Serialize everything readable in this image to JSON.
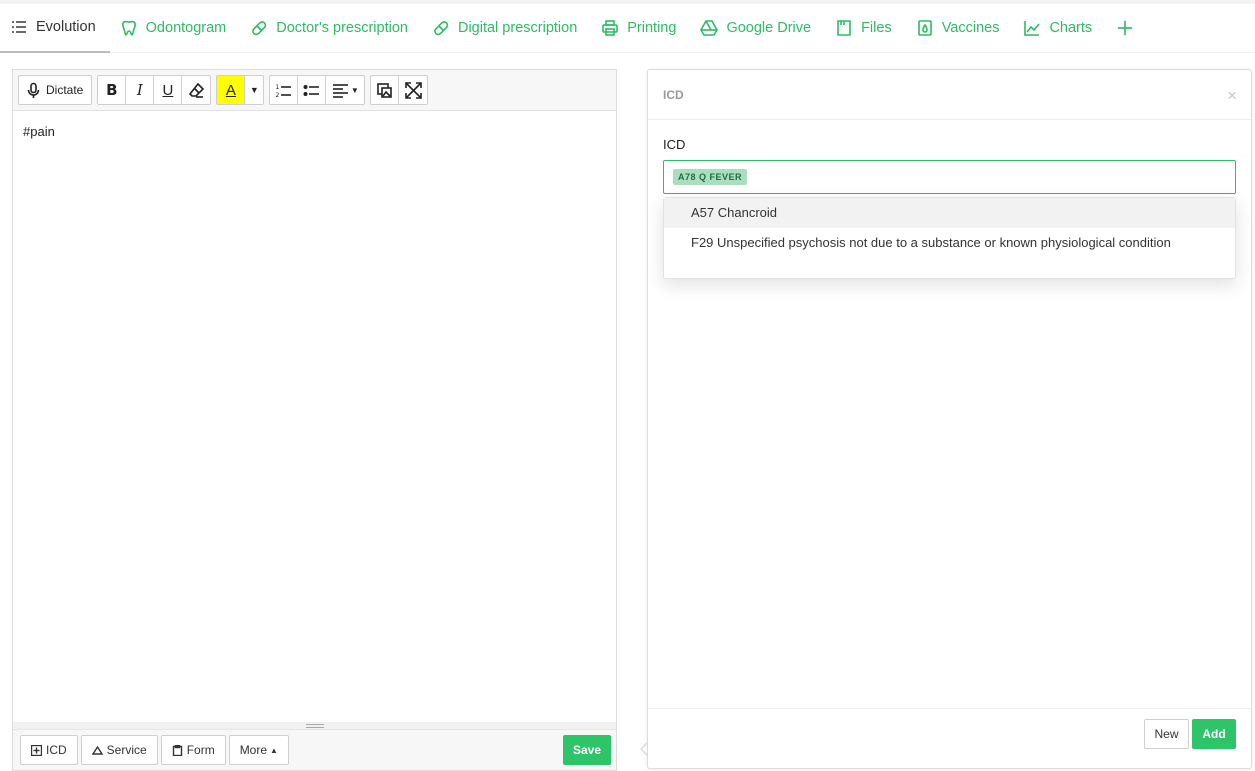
{
  "tabs": [
    {
      "label": "Evolution",
      "icon": "list-icon",
      "active": true
    },
    {
      "label": "Odontogram",
      "icon": "tooth-icon"
    },
    {
      "label": "Doctor's prescription",
      "icon": "pill-icon"
    },
    {
      "label": "Digital prescription",
      "icon": "pill-icon"
    },
    {
      "label": "Printing",
      "icon": "printer-icon"
    },
    {
      "label": "Google Drive",
      "icon": "google-drive-icon"
    },
    {
      "label": "Files",
      "icon": "file-icon"
    },
    {
      "label": "Vaccines",
      "icon": "vaccine-icon"
    },
    {
      "label": "Charts",
      "icon": "chart-icon"
    }
  ],
  "editor": {
    "toolbar": {
      "dictate_label": "Dictate",
      "bold_label": "B",
      "italic_label": "I",
      "underline_label": "U",
      "highlight_label": "A",
      "highlight_color": "#ffff00"
    },
    "content": "#pain",
    "footer": {
      "icd_label": "ICD",
      "service_label": "Service",
      "form_label": "Form",
      "more_label": "More",
      "save_label": "Save"
    }
  },
  "modal": {
    "title": "ICD",
    "close_symbol": "×",
    "field_label": "ICD",
    "selected_tag": "A78 Q FEVER",
    "options": [
      "A57 Chancroid",
      "F29 Unspecified psychosis not due to a substance or known physiological condition"
    ],
    "new_label": "New",
    "add_label": "Add"
  },
  "colors": {
    "accent": "#2dbb64",
    "button_green": "#2ec468",
    "tag_bg": "#a9dfbf"
  }
}
